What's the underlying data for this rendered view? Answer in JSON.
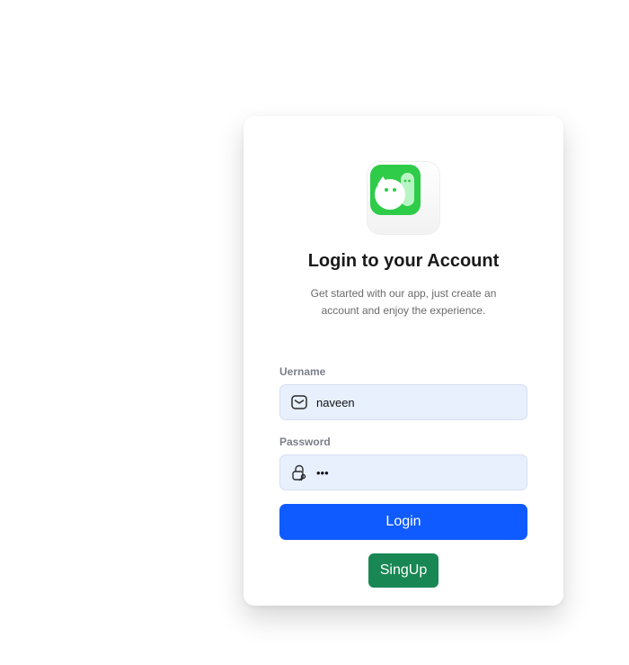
{
  "logo": {
    "icon": "chat-bubbles-app-logo",
    "color": "#2ecc48"
  },
  "title": "Login to your Account",
  "subtitle": "Get started with our app, just create an account and enjoy the experience.",
  "username": {
    "label": "Uername",
    "value": "naveen",
    "icon": "mail-icon"
  },
  "password": {
    "label": "Password",
    "value": "•••",
    "icon": "lock-icon"
  },
  "buttons": {
    "login": "Login",
    "signup": "SingUp"
  },
  "colors": {
    "primary": "#0f5bff",
    "success": "#198754",
    "input_bg": "#e8f0fe"
  }
}
